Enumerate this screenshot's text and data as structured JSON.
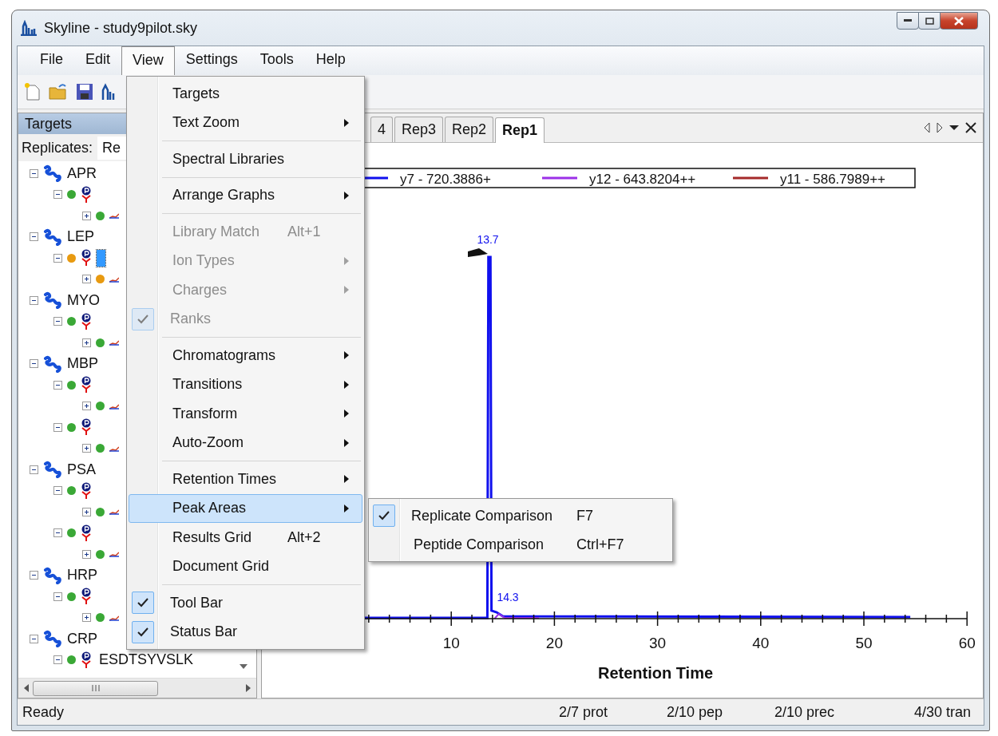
{
  "window": {
    "title": "Skyline - study9pilot.sky"
  },
  "menubar": [
    {
      "label": "File",
      "selected": false
    },
    {
      "label": "Edit",
      "selected": false
    },
    {
      "label": "View",
      "selected": true
    },
    {
      "label": "Settings",
      "selected": false
    },
    {
      "label": "Tools",
      "selected": false
    },
    {
      "label": "Help",
      "selected": false
    }
  ],
  "targets_pane": {
    "title": "Targets",
    "replicates_label": "Replicates:",
    "replicates_value": "Re",
    "tree": [
      {
        "label": "APR",
        "expanded": true,
        "children": [
          {
            "kind": "peptide",
            "color": "#3aa836",
            "expanded": true,
            "selected": false,
            "children": [
              {
                "kind": "precursor",
                "color": "#3aa836",
                "expanded": false
              }
            ]
          }
        ]
      },
      {
        "label": "LEP",
        "expanded": true,
        "children": [
          {
            "kind": "peptide",
            "color": "#e89a10",
            "expanded": true,
            "selected": true,
            "children": [
              {
                "kind": "precursor",
                "color": "#e89a10",
                "expanded": false
              }
            ]
          }
        ]
      },
      {
        "label": "MYO",
        "expanded": true,
        "children": [
          {
            "kind": "peptide",
            "color": "#3aa836",
            "expanded": true,
            "selected": false,
            "children": [
              {
                "kind": "precursor",
                "color": "#3aa836",
                "expanded": false
              }
            ]
          }
        ]
      },
      {
        "label": "MBP",
        "expanded": true,
        "children": [
          {
            "kind": "peptide",
            "color": "#3aa836",
            "expanded": true,
            "selected": false,
            "children": [
              {
                "kind": "precursor",
                "color": "#3aa836",
                "expanded": false
              }
            ]
          },
          {
            "kind": "peptide",
            "color": "#3aa836",
            "expanded": true,
            "selected": false,
            "children": [
              {
                "kind": "precursor",
                "color": "#3aa836",
                "expanded": false
              }
            ]
          }
        ]
      },
      {
        "label": "PSA",
        "expanded": true,
        "children": [
          {
            "kind": "peptide",
            "color": "#3aa836",
            "expanded": true,
            "selected": false,
            "children": [
              {
                "kind": "precursor",
                "color": "#3aa836",
                "expanded": false
              }
            ]
          },
          {
            "kind": "peptide",
            "color": "#3aa836",
            "expanded": true,
            "selected": false,
            "children": [
              {
                "kind": "precursor",
                "color": "#3aa836",
                "expanded": false
              }
            ]
          }
        ]
      },
      {
        "label": "HRP",
        "expanded": true,
        "children": [
          {
            "kind": "peptide",
            "color": "#3aa836",
            "expanded": true,
            "selected": false,
            "children": [
              {
                "kind": "precursor",
                "color": "#3aa836",
                "expanded": false
              }
            ]
          }
        ]
      },
      {
        "label": "CRP",
        "expanded": true,
        "children": [
          {
            "kind": "peptide",
            "color": "#3aa836",
            "expanded": true,
            "selected": false,
            "label": "ESDTSYVSLK"
          }
        ]
      }
    ]
  },
  "graph_pane": {
    "tabs": [
      {
        "label": "4",
        "selected": false
      },
      {
        "label": "Rep3",
        "selected": false
      },
      {
        "label": "Rep2",
        "selected": false
      },
      {
        "label": "Rep1",
        "selected": true
      }
    ],
    "chart": {
      "legend": [
        {
          "label": "y7 - 720.3886+",
          "color": "#1010ee"
        },
        {
          "label": "y12 - 643.8204++",
          "color": "#9b30e8"
        },
        {
          "label": "y11 - 586.7989++",
          "color": "#a52a2a"
        }
      ],
      "peak_labels": [
        "13.7",
        "14.3"
      ],
      "xticks": [
        "10",
        "20",
        "30",
        "40",
        "50",
        "60"
      ],
      "xlabel": "Retention Time"
    }
  },
  "view_menu": [
    {
      "kind": "item",
      "label": "Targets",
      "submenu": false,
      "disabled": false,
      "checked": false,
      "selected": false
    },
    {
      "kind": "item",
      "label": "Text Zoom",
      "submenu": true,
      "disabled": false,
      "checked": false,
      "selected": false
    },
    {
      "kind": "separator"
    },
    {
      "kind": "item",
      "label": "Spectral Libraries",
      "submenu": false,
      "disabled": false,
      "checked": false,
      "selected": false
    },
    {
      "kind": "separator"
    },
    {
      "kind": "item",
      "label": "Arrange Graphs",
      "submenu": true,
      "disabled": false,
      "checked": false,
      "selected": false
    },
    {
      "kind": "separator"
    },
    {
      "kind": "item",
      "label": "Library Match",
      "shortcut": "Alt+1",
      "submenu": false,
      "disabled": true,
      "checked": false,
      "selected": false
    },
    {
      "kind": "item",
      "label": "Ion Types",
      "submenu": true,
      "disabled": true,
      "checked": false,
      "selected": false
    },
    {
      "kind": "item",
      "label": "Charges",
      "submenu": true,
      "disabled": true,
      "checked": false,
      "selected": false
    },
    {
      "kind": "item",
      "label": "Ranks",
      "submenu": false,
      "disabled": true,
      "checked": true,
      "selected": false
    },
    {
      "kind": "separator"
    },
    {
      "kind": "item",
      "label": "Chromatograms",
      "submenu": true,
      "disabled": false,
      "checked": false,
      "selected": false
    },
    {
      "kind": "item",
      "label": "Transitions",
      "submenu": true,
      "disabled": false,
      "checked": false,
      "selected": false
    },
    {
      "kind": "item",
      "label": "Transform",
      "submenu": true,
      "disabled": false,
      "checked": false,
      "selected": false
    },
    {
      "kind": "item",
      "label": "Auto-Zoom",
      "submenu": true,
      "disabled": false,
      "checked": false,
      "selected": false
    },
    {
      "kind": "separator"
    },
    {
      "kind": "item",
      "label": "Retention Times",
      "submenu": true,
      "disabled": false,
      "checked": false,
      "selected": false
    },
    {
      "kind": "item",
      "label": "Peak Areas",
      "submenu": true,
      "disabled": false,
      "checked": false,
      "selected": true
    },
    {
      "kind": "item",
      "label": "Results Grid",
      "shortcut": "Alt+2",
      "submenu": false,
      "disabled": false,
      "checked": false,
      "selected": false
    },
    {
      "kind": "item",
      "label": "Document Grid",
      "submenu": false,
      "disabled": false,
      "checked": false,
      "selected": false
    },
    {
      "kind": "separator"
    },
    {
      "kind": "item",
      "label": "Tool Bar",
      "submenu": false,
      "disabled": false,
      "checked": true,
      "selected": false
    },
    {
      "kind": "item",
      "label": "Status Bar",
      "submenu": false,
      "disabled": false,
      "checked": true,
      "selected": false
    }
  ],
  "peak_areas_submenu": [
    {
      "label": "Replicate Comparison",
      "shortcut": "F7",
      "checked": true
    },
    {
      "label": "Peptide Comparison",
      "shortcut": "Ctrl+F7",
      "checked": false
    }
  ],
  "status_bar": {
    "message": "Ready",
    "counts": [
      "2/7 prot",
      "2/10 pep",
      "2/10 prec",
      "4/30 tran"
    ]
  }
}
